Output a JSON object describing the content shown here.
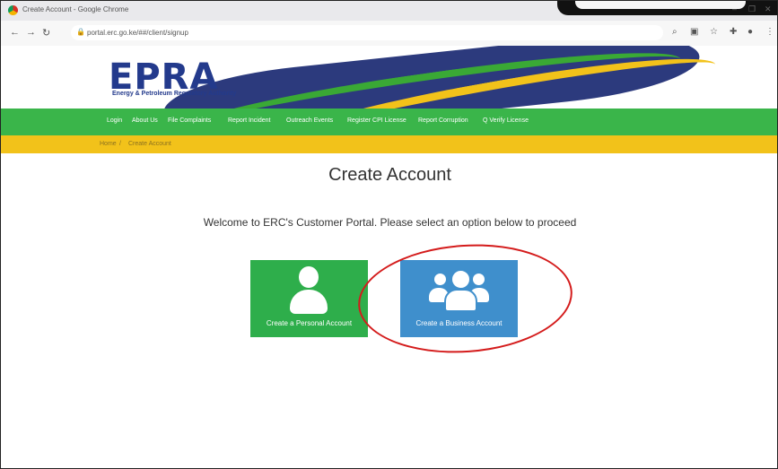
{
  "browser": {
    "tab_title": "Create Account - Google Chrome",
    "url": "portal.erc.go.ke/##/client/signup",
    "window_controls": [
      "–",
      "❐",
      "✕"
    ]
  },
  "site": {
    "logo_text": "EPRA",
    "logo_subtitle": "Energy & Petroleum Regulatory Authority",
    "nav": [
      "Login",
      "About Us",
      "File Complaints",
      "Report Incident",
      "Outreach Events",
      "Register CPI License",
      "Report Corruption",
      "Q Verify License"
    ],
    "breadcrumb": [
      "Home",
      "Create Account"
    ]
  },
  "main": {
    "title": "Create Account",
    "welcome": "Welcome to ERC's Customer Portal. Please select an option below to proceed",
    "options": [
      {
        "label": "Create a Personal Account",
        "icon": "user-icon"
      },
      {
        "label": "Create a Business Account",
        "icon": "group-icon"
      }
    ]
  },
  "colors": {
    "green": "#3ab54a",
    "yellow": "#f2c21a",
    "blue_card": "#3f8fcc",
    "green_card": "#2eae4b",
    "highlight": "#d41b1b"
  }
}
